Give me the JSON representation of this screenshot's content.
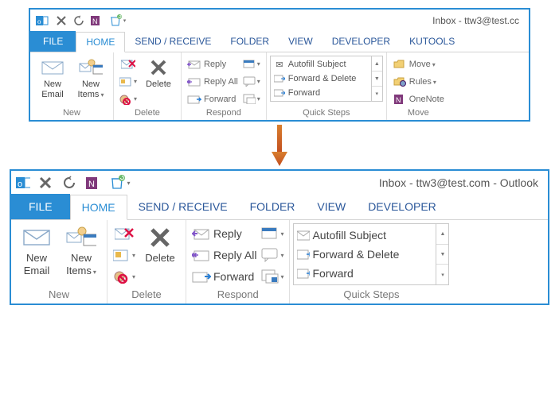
{
  "w1": {
    "title": "Inbox - ttw3@test.cc",
    "tabs": {
      "file": "FILE",
      "home": "HOME",
      "sendrecv": "SEND / RECEIVE",
      "folder": "FOLDER",
      "view": "VIEW",
      "developer": "DEVELOPER",
      "kutools": "KUTOOLS"
    },
    "groups": {
      "new": "New",
      "delete": "Delete",
      "respond": "Respond",
      "quicksteps": "Quick Steps",
      "move": "Move"
    },
    "btn": {
      "new_email": "New Email",
      "new_items": "New Items",
      "delete": "Delete",
      "reply": "Reply",
      "reply_all": "Reply All",
      "forward": "Forward",
      "move": "Move",
      "rules": "Rules",
      "onenote": "OneNote"
    },
    "qs": [
      "Autofill Subject",
      "Forward & Delete",
      "Forward"
    ]
  },
  "w2": {
    "title": "Inbox - ttw3@test.com - Outlook",
    "tabs": {
      "file": "FILE",
      "home": "HOME",
      "sendrecv": "SEND / RECEIVE",
      "folder": "FOLDER",
      "view": "VIEW",
      "developer": "DEVELOPER"
    },
    "groups": {
      "new": "New",
      "delete": "Delete",
      "respond": "Respond",
      "quicksteps": "Quick Steps"
    },
    "btn": {
      "new_email": "New Email",
      "new_items": "New Items",
      "delete": "Delete",
      "reply": "Reply",
      "reply_all": "Reply All",
      "forward": "Forward"
    },
    "qs": [
      "Autofill Subject",
      "Forward & Delete",
      "Forward"
    ]
  }
}
